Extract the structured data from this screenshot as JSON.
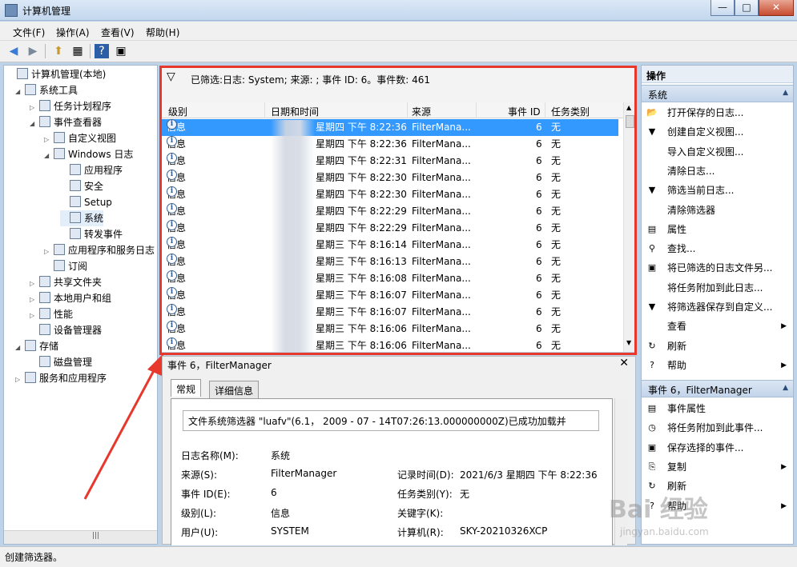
{
  "window": {
    "title": "计算机管理",
    "min": "—",
    "max": "□",
    "close": "✕"
  },
  "menu": [
    "文件(F)",
    "操作(A)",
    "查看(V)",
    "帮助(H)"
  ],
  "toolbar": {
    "back": "◀",
    "forward": "▶",
    "up": "⬆",
    "view": "▦",
    "help": "?",
    "view2": "▣"
  },
  "tree": [
    {
      "label": "计算机管理(本地)",
      "tri": ""
    },
    {
      "label": "系统工具",
      "tri": "◢"
    },
    {
      "label": "任务计划程序",
      "tri": "▷"
    },
    {
      "label": "事件查看器",
      "tri": "◢"
    },
    {
      "label": "自定义视图",
      "tri": "▷"
    },
    {
      "label": "Windows 日志",
      "tri": "◢"
    },
    {
      "label": "应用程序",
      "tri": ""
    },
    {
      "label": "安全",
      "tri": ""
    },
    {
      "label": "Setup",
      "tri": ""
    },
    {
      "label": "系统",
      "tri": ""
    },
    {
      "label": "转发事件",
      "tri": ""
    },
    {
      "label": "应用程序和服务日志",
      "tri": "▷"
    },
    {
      "label": "订阅",
      "tri": ""
    },
    {
      "label": "共享文件夹",
      "tri": "▷"
    },
    {
      "label": "本地用户和组",
      "tri": "▷"
    },
    {
      "label": "性能",
      "tri": "▷"
    },
    {
      "label": "设备管理器",
      "tri": ""
    },
    {
      "label": "存储",
      "tri": "◢"
    },
    {
      "label": "磁盘管理",
      "tri": ""
    },
    {
      "label": "服务和应用程序",
      "tri": "▷"
    }
  ],
  "tree_scroll": "|||",
  "filter": {
    "text": "已筛选:日志: System; 来源: ; 事件 ID: 6。事件数: 461"
  },
  "grid": {
    "headers": [
      "级别",
      "日期和时间",
      "来源",
      "事件 ID",
      "任务类别"
    ],
    "rows": [
      {
        "level": "信息",
        "date": "星期四 下午 8:22:36",
        "source": "FilterMana...",
        "id": "6",
        "cat": "无"
      },
      {
        "level": "信息",
        "date": "星期四 下午 8:22:36",
        "source": "FilterMana...",
        "id": "6",
        "cat": "无"
      },
      {
        "level": "信息",
        "date": "星期四 下午 8:22:31",
        "source": "FilterMana...",
        "id": "6",
        "cat": "无"
      },
      {
        "level": "信息",
        "date": "星期四 下午 8:22:30",
        "source": "FilterMana...",
        "id": "6",
        "cat": "无"
      },
      {
        "level": "信息",
        "date": "星期四 下午 8:22:30",
        "source": "FilterMana...",
        "id": "6",
        "cat": "无"
      },
      {
        "level": "信息",
        "date": "星期四 下午 8:22:29",
        "source": "FilterMana...",
        "id": "6",
        "cat": "无"
      },
      {
        "level": "信息",
        "date": "星期四 下午 8:22:29",
        "source": "FilterMana...",
        "id": "6",
        "cat": "无"
      },
      {
        "level": "信息",
        "date": "星期三 下午 8:16:14",
        "source": "FilterMana...",
        "id": "6",
        "cat": "无"
      },
      {
        "level": "信息",
        "date": "星期三 下午 8:16:13",
        "source": "FilterMana...",
        "id": "6",
        "cat": "无"
      },
      {
        "level": "信息",
        "date": "星期三 下午 8:16:08",
        "source": "FilterMana...",
        "id": "6",
        "cat": "无"
      },
      {
        "level": "信息",
        "date": "星期三 下午 8:16:07",
        "source": "FilterMana...",
        "id": "6",
        "cat": "无"
      },
      {
        "level": "信息",
        "date": "星期三 下午 8:16:07",
        "source": "FilterMana...",
        "id": "6",
        "cat": "无"
      },
      {
        "level": "信息",
        "date": "星期三 下午 8:16:06",
        "source": "FilterMana...",
        "id": "6",
        "cat": "无"
      },
      {
        "level": "信息",
        "date": "星期三 下午 8:16:06",
        "source": "FilterMana...",
        "id": "6",
        "cat": "无"
      }
    ]
  },
  "detail": {
    "title": "事件 6，FilterManager",
    "close": "✕",
    "tabs": [
      "常规",
      "详细信息"
    ],
    "description": "文件系统筛选器 \"luafv\"(6.1，  2009  -  07  -  14T07:26:13.000000000Z)已成功加载并",
    "fields": {
      "log_name_label": "日志名称(M):",
      "log_name": "系统",
      "source_label": "来源(S):",
      "source": "FilterManager",
      "recorded_label": "记录时间(D):",
      "recorded": "2021/6/3 星期四 下午 8:22:36",
      "event_id_label": "事件 ID(E):",
      "event_id": "6",
      "task_label": "任务类别(Y):",
      "task": "无",
      "level_label": "级别(L):",
      "level": "信息",
      "keywords_label": "关键字(K):",
      "user_label": "用户(U):",
      "user": "SYSTEM",
      "computer_label": "计算机(R):",
      "computer": "SKY-20210326XCP"
    }
  },
  "actions": {
    "title": "操作",
    "section1": "系统",
    "items1": [
      {
        "label": "打开保存的日志...",
        "icon": "📂",
        "arrow": ""
      },
      {
        "label": "创建自定义视图...",
        "icon": "▼",
        "arrow": ""
      },
      {
        "label": "导入自定义视图...",
        "icon": "",
        "arrow": ""
      },
      {
        "label": "清除日志...",
        "icon": "",
        "arrow": ""
      },
      {
        "label": "筛选当前日志...",
        "icon": "▼",
        "arrow": ""
      },
      {
        "label": "清除筛选器",
        "icon": "",
        "arrow": ""
      },
      {
        "label": "属性",
        "icon": "▤",
        "arrow": ""
      },
      {
        "label": "查找...",
        "icon": "⚲",
        "arrow": ""
      },
      {
        "label": "将已筛选的日志文件另...",
        "icon": "▣",
        "arrow": ""
      },
      {
        "label": "将任务附加到此日志...",
        "icon": "",
        "arrow": ""
      },
      {
        "label": "将筛选器保存到自定义...",
        "icon": "▼",
        "arrow": ""
      },
      {
        "label": "查看",
        "icon": "",
        "arrow": "▶"
      },
      {
        "label": "刷新",
        "icon": "↻",
        "arrow": ""
      },
      {
        "label": "帮助",
        "icon": "?",
        "arrow": "▶"
      }
    ],
    "section2": "事件 6，FilterManager",
    "items2": [
      {
        "label": "事件属性",
        "icon": "▤",
        "arrow": ""
      },
      {
        "label": "将任务附加到此事件...",
        "icon": "◷",
        "arrow": ""
      },
      {
        "label": "保存选择的事件...",
        "icon": "▣",
        "arrow": ""
      },
      {
        "label": "复制",
        "icon": "⎘",
        "arrow": "▶"
      },
      {
        "label": "刷新",
        "icon": "↻",
        "arrow": ""
      },
      {
        "label": "帮助",
        "icon": "?",
        "arrow": "▶"
      }
    ]
  },
  "status": "创建筛选器。",
  "watermark": {
    "logo": "Bai 经验",
    "url": "jingyan.baidu.com"
  }
}
